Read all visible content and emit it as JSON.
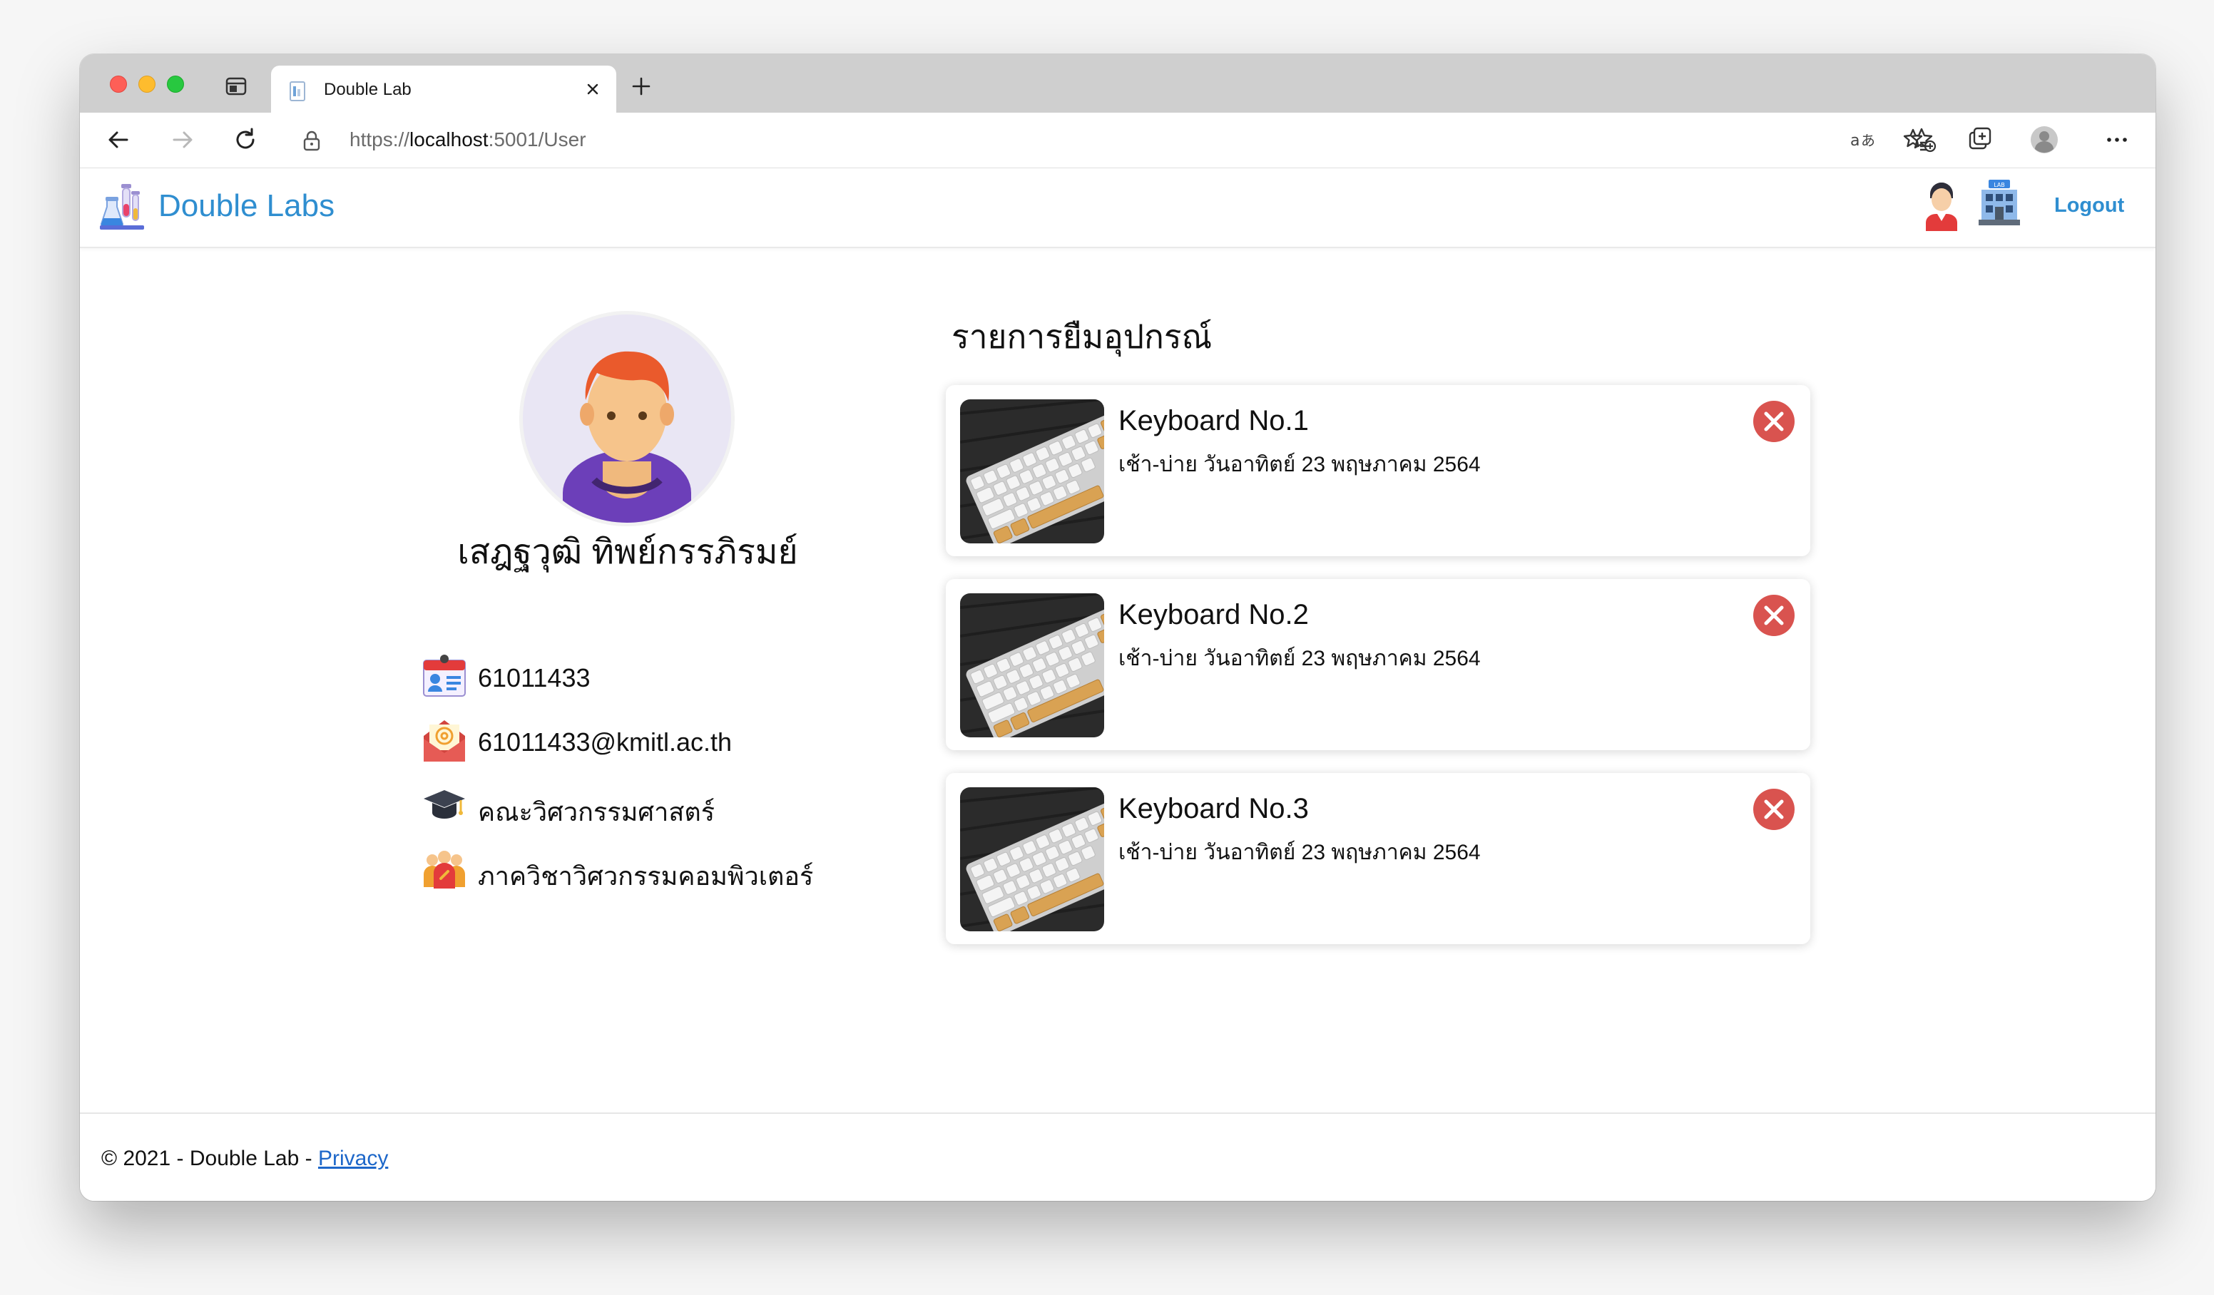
{
  "browser": {
    "tab_title": "Double Lab",
    "url_scheme": "https://",
    "url_host": "localhost",
    "url_rest": ":5001/User"
  },
  "navbar": {
    "brand": "Double Labs",
    "logout_label": "Logout"
  },
  "profile": {
    "name": "เสฎฐวุฒิ ทิพย์กรรภิรมย์",
    "student_id": "61011433",
    "email": "61011433@kmitl.ac.th",
    "faculty": "คณะวิศวกรรมศาสตร์",
    "department": "ภาควิชาวิศวกรรมคอมพิวเตอร์"
  },
  "borrow_list": {
    "title": "รายการยืมอุปกรณ์",
    "items": [
      {
        "name": "Keyboard No.1",
        "time": "เช้า-บ่าย วันอาทิตย์ 23 พฤษภาคม 2564"
      },
      {
        "name": "Keyboard No.2",
        "time": "เช้า-บ่าย วันอาทิตย์ 23 พฤษภาคม 2564"
      },
      {
        "name": "Keyboard No.3",
        "time": "เช้า-บ่าย วันอาทิตย์ 23 พฤษภาคม 2564"
      }
    ]
  },
  "footer": {
    "text": "© 2021 - Double Lab - ",
    "privacy_label": "Privacy"
  },
  "icons": {
    "brand": "flask-lab-icon",
    "user": "user-avatar-icon",
    "lab": "lab-building-icon",
    "student_id": "id-card-icon",
    "email": "email-envelope-icon",
    "faculty": "graduation-cap-icon",
    "department": "group-people-icon",
    "remove": "close-circle-icon"
  },
  "colors": {
    "brand": "#2f8ed0",
    "remove": "#d9534f",
    "link": "#1d67c9"
  }
}
